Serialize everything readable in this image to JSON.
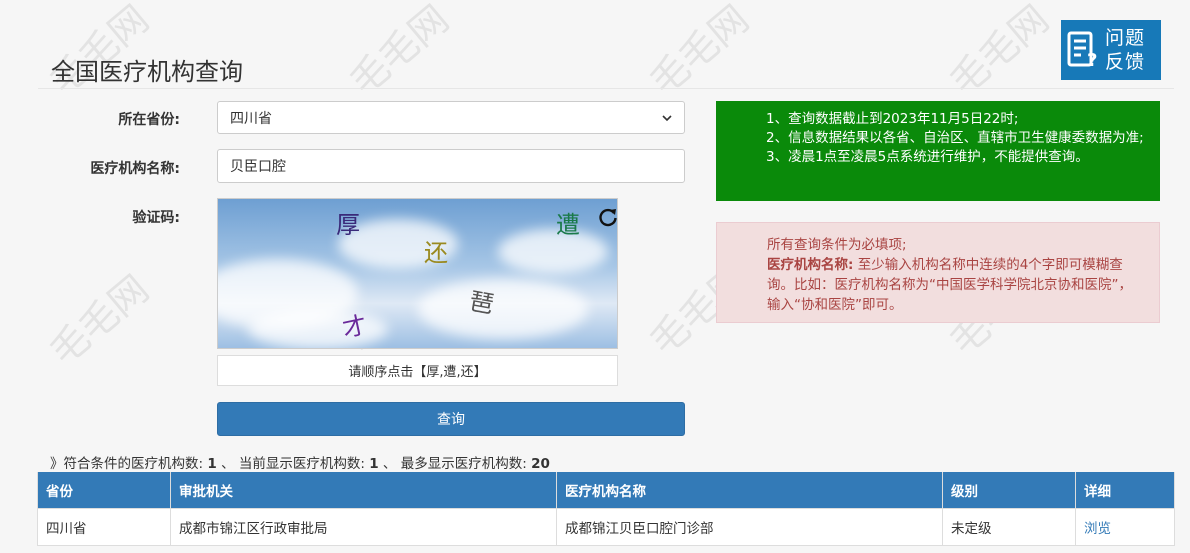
{
  "page": {
    "title": "全国医疗机构查询"
  },
  "feedback": {
    "line1": "问题",
    "line2": "反馈"
  },
  "form": {
    "province_label": "所在省份:",
    "province_value": "四川省",
    "name_label": "医疗机构名称:",
    "name_value": "贝臣口腔",
    "captcha_label": "验证码:",
    "captcha_chars": [
      "厚",
      "遭",
      "还",
      "琶",
      "才"
    ],
    "captcha_hint": "请顺序点击【厚,遭,还】",
    "query_button": "查询"
  },
  "notices": {
    "green": [
      "1、查询数据截止到2023年11月5日22时;",
      "2、信息数据结果以各省、自治区、直辖市卫生健康委数据为准;",
      "3、凌晨1点至凌晨5点系统进行维护，不能提供查询。"
    ],
    "red": {
      "line1": "所有查询条件为必填项;",
      "label": "医疗机构名称:",
      "text": " 至少输入机构名称中连续的4个字即可模糊查询。比如：医疗机构名称为“中国医学科学院北京协和医院”，输入“协和医院”即可。"
    }
  },
  "summary": {
    "matched_label": "》符合条件的医疗机构数:",
    "matched": "1",
    "sep1": "、",
    "shown_label": "当前显示医疗机构数:",
    "shown": "1",
    "sep2": "、",
    "max_label": "最多显示医疗机构数:",
    "max": "20"
  },
  "table": {
    "headers": [
      "省份",
      "审批机关",
      "医疗机构名称",
      "级别",
      "详细"
    ],
    "rows": [
      [
        "四川省",
        "成都市锦江区行政审批局",
        "成都锦江贝臣口腔门诊部",
        "未定级",
        "浏览"
      ]
    ]
  },
  "watermark": "毛毛网",
  "colors": {
    "primary": "#337ab7",
    "notice_green": "#0a8a0a",
    "notice_red_bg": "#f2dede",
    "notice_red_text": "#a94442",
    "feedback_bg": "#1779b8"
  }
}
